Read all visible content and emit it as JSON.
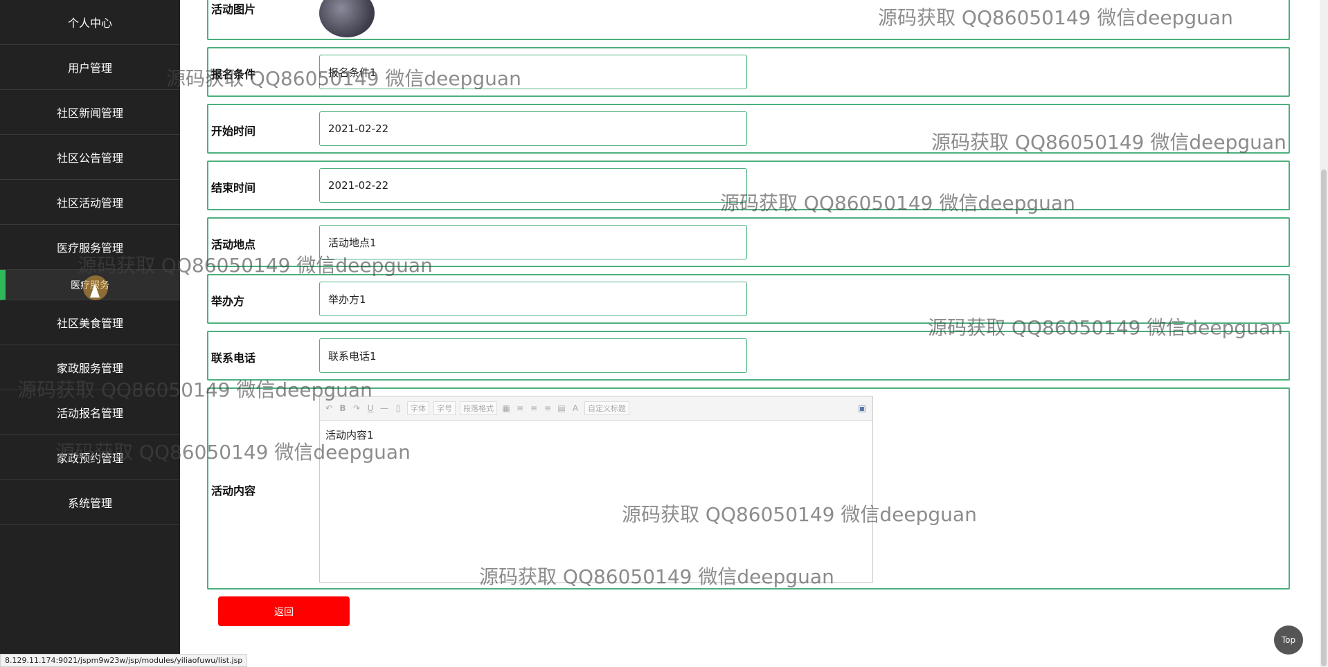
{
  "sidebar": {
    "items": [
      {
        "label": "个人中心"
      },
      {
        "label": "用户管理"
      },
      {
        "label": "社区新闻管理"
      },
      {
        "label": "社区公告管理"
      },
      {
        "label": "社区活动管理"
      },
      {
        "label": "医疗服务管理"
      },
      {
        "label": "医疗服务"
      },
      {
        "label": "社区美食管理"
      },
      {
        "label": "家政服务管理"
      },
      {
        "label": "活动报名管理"
      },
      {
        "label": "家政预约管理"
      },
      {
        "label": "系统管理"
      }
    ]
  },
  "form": {
    "image_label": "活动图片",
    "conditions_label": "报名条件",
    "conditions_value": "报名条件1",
    "start_label": "开始时间",
    "start_value": "2021-02-22",
    "end_label": "结束时间",
    "end_value": "2021-02-22",
    "location_label": "活动地点",
    "location_value": "活动地点1",
    "organizer_label": "举办方",
    "organizer_value": "举办方1",
    "phone_label": "联系电话",
    "phone_value": "联系电话1",
    "content_label": "活动内容",
    "content_value": "活动内容1"
  },
  "editor": {
    "font_select": "字体",
    "size_select": "字号",
    "para_select": "段落格式",
    "custom_title_select": "自定义标题",
    "bold": "B",
    "underline": "U",
    "font_color": "A"
  },
  "actions": {
    "back_label": "返回",
    "top_label": "Top"
  },
  "status_url": "8.129.11.174:9021/jspm9w23w/jsp/modules/yiliaofuwu/list.jsp",
  "watermark": "源码获取 QQ86050149 微信deepguan",
  "colors": {
    "sidebar_bg": "#222222",
    "accent_green": "#4caf7d",
    "active_indicator": "#2fb85a",
    "back_button": "#ff0000"
  }
}
